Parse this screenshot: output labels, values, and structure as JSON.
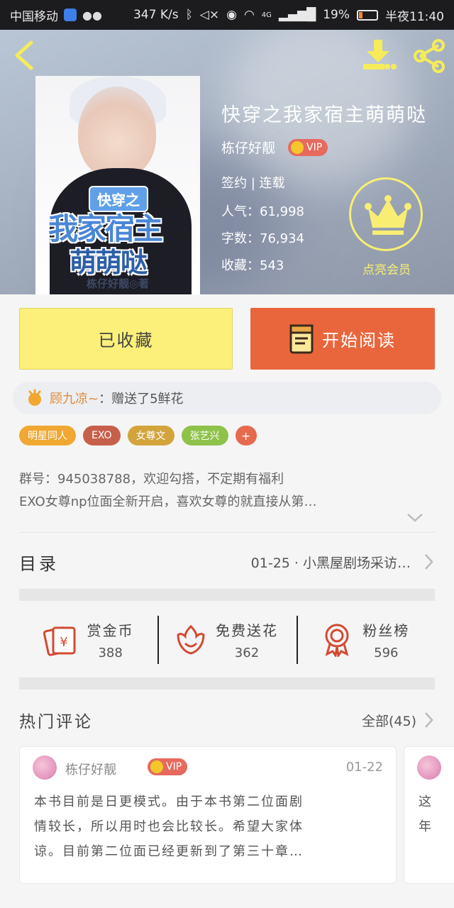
{
  "status_bar": {
    "carrier": "中国移动",
    "speed": "347 K/s",
    "network": "4G",
    "battery": "19%",
    "time": "半夜11:40"
  },
  "book": {
    "title": "快穿之我家宿主萌萌哒",
    "author": "栋仔好靓",
    "vip_label": "VIP",
    "status": "签约 | 连载",
    "popularity": "人气：61,998",
    "word_count": "字数：76,934",
    "favorites": "收藏：543",
    "cover": {
      "tag": "快穿之",
      "line1": "我家宿主",
      "line2": "萌萌哒",
      "author": "栋仔好靓◎著"
    }
  },
  "member": {
    "label": "点亮会员"
  },
  "actions": {
    "favorite_label": "已收藏",
    "read_label": "开始阅读"
  },
  "gift": {
    "user": "顾九凉~",
    "message": "：赠送了5鲜花"
  },
  "tags": [
    {
      "label": "明星同人",
      "color": "#f0a832"
    },
    {
      "label": "EXO",
      "color": "#c7604b"
    },
    {
      "label": "女尊文",
      "color": "#d4a43c"
    },
    {
      "label": "张艺兴",
      "color": "#8fc24a"
    }
  ],
  "tag_more": "+",
  "description": {
    "line1": "群号：945038788，欢迎勾搭，不定期有福利",
    "line2": "EXO女尊np位面全新开启，喜欢女尊的就直接从第…"
  },
  "toc": {
    "title": "目录",
    "latest": "01-25 · 小黑屋剧场采访…"
  },
  "stats": [
    {
      "label": "赏金币",
      "value": "388"
    },
    {
      "label": "免费送花",
      "value": "362"
    },
    {
      "label": "粉丝榜",
      "value": "596"
    }
  ],
  "comments": {
    "title": "热门评论",
    "all_label": "全部(45)",
    "items": [
      {
        "user": "栋仔好靓",
        "vip": "VIP",
        "date": "01-22",
        "line1": "本书目前是日更模式。由于本书第二位面剧",
        "line2": "情较长，所以用时也会比较长。希望大家体",
        "line3": "谅。目前第二位面已经更新到了第三十章…"
      },
      {
        "line1": "这",
        "line2": "年"
      }
    ]
  },
  "colors": {
    "accent_orange": "#e9663d",
    "favorite_yellow": "#fcf07a",
    "member_yellow": "#f8ee73",
    "icon_red": "#d24a32"
  }
}
